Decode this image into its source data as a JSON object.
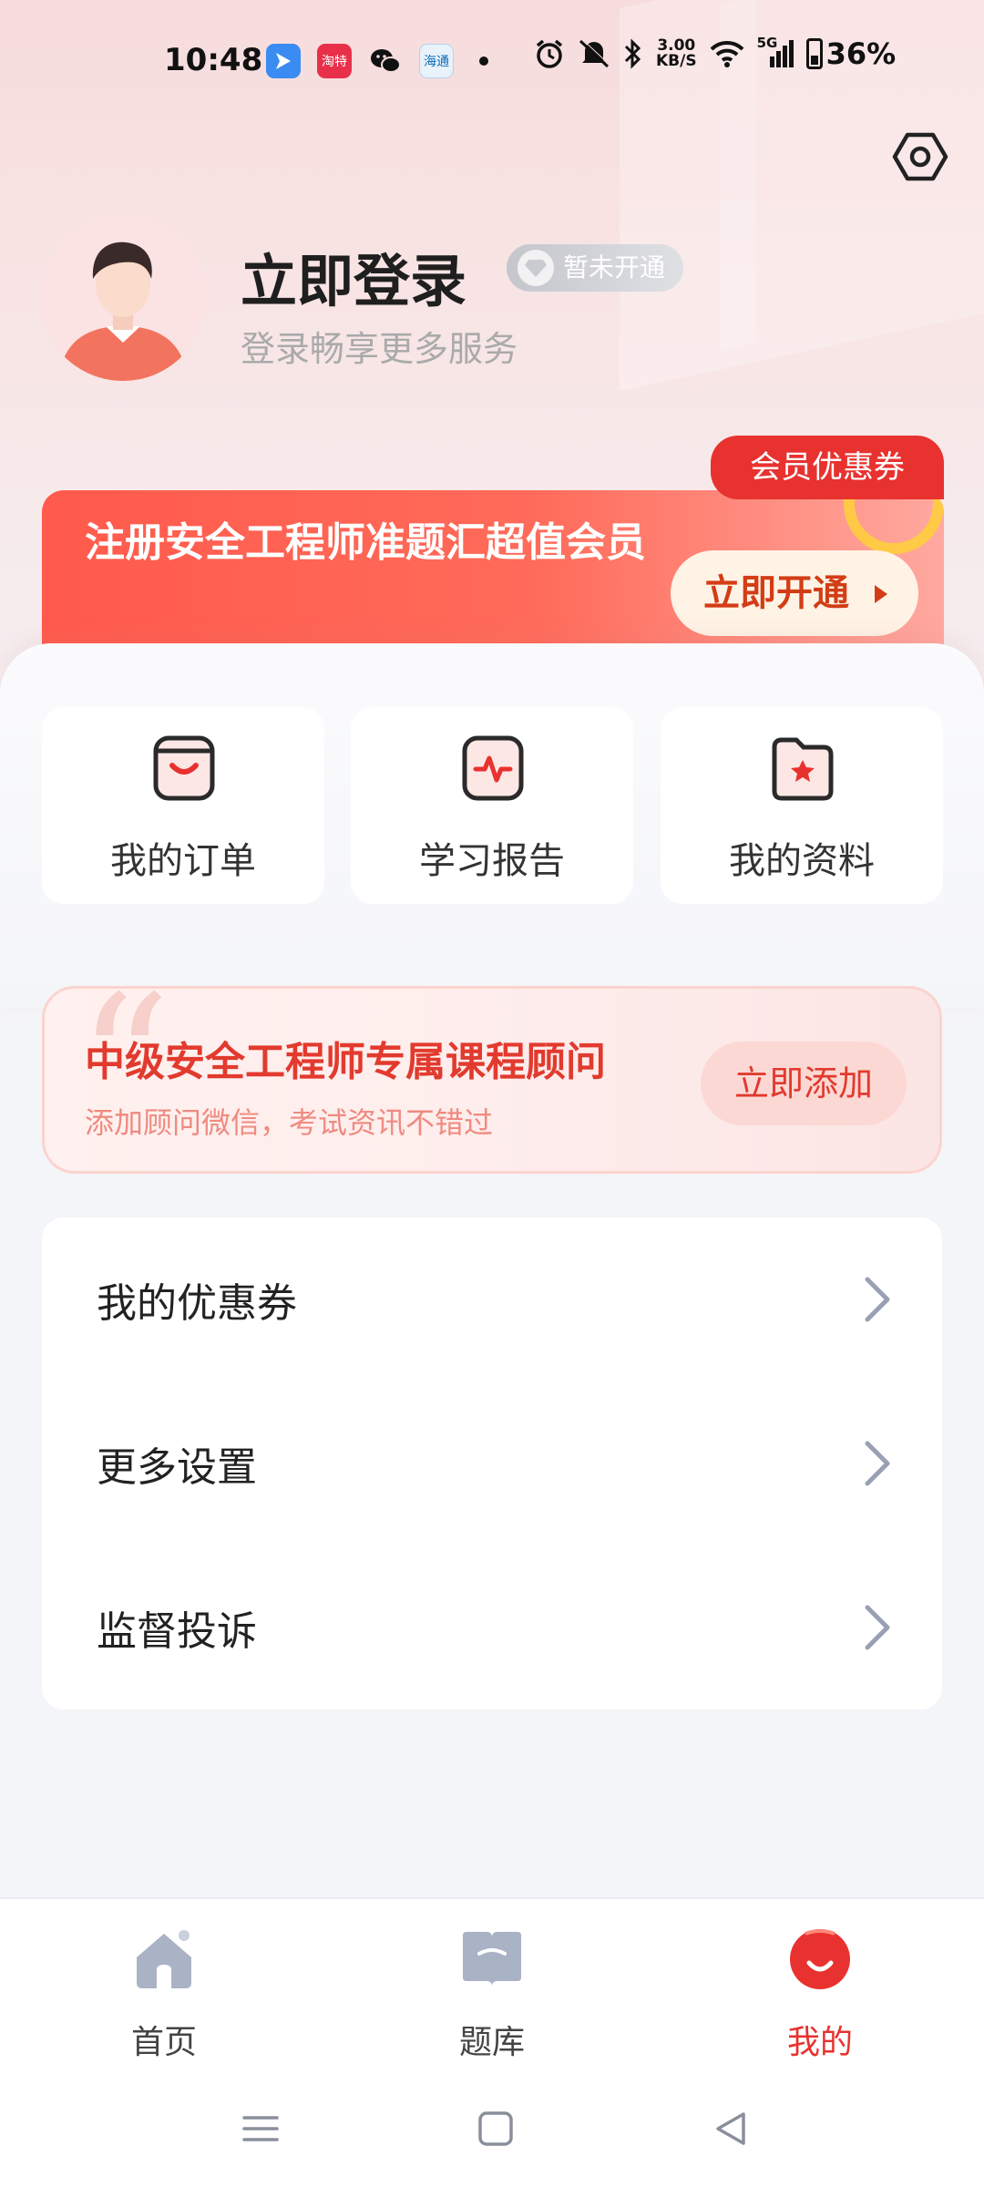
{
  "status_bar": {
    "time": "10:48",
    "speed": "3.00\nKB/S",
    "signal": "5G",
    "battery": "36%"
  },
  "app_icons": [
    "bird-app-icon",
    "taote-618-icon",
    "wechat-icon",
    "haitong-app-icon"
  ],
  "app_icon_text": {
    "taote": "淘特",
    "ht": "海通"
  },
  "profile": {
    "title": "立即登录",
    "vip_status": "暂未开通",
    "subtitle": "登录畅享更多服务"
  },
  "member_banner": {
    "coupon_tag": "会员优惠券",
    "title": "注册安全工程师准题汇超值会员",
    "cta": "立即开通"
  },
  "quick_actions": [
    {
      "label": "我的订单",
      "icon": "order-bag-icon"
    },
    {
      "label": "学习报告",
      "icon": "report-pulse-icon"
    },
    {
      "label": "我的资料",
      "icon": "folder-star-icon"
    }
  ],
  "consultant": {
    "title": "中级安全工程师专属课程顾问",
    "subtitle": "添加顾问微信，考试资讯不错过",
    "cta": "立即添加"
  },
  "menu": [
    {
      "label": "我的优惠券"
    },
    {
      "label": "更多设置"
    },
    {
      "label": "监督投诉"
    }
  ],
  "bottom_nav": [
    {
      "label": "首页",
      "icon": "home-icon",
      "active": false
    },
    {
      "label": "题库",
      "icon": "book-icon",
      "active": false
    },
    {
      "label": "我的",
      "icon": "profile-icon",
      "active": true
    }
  ],
  "colors": {
    "accent": "#e8322f",
    "banner": "#ff5a4c",
    "background": "#f4f5f8"
  }
}
